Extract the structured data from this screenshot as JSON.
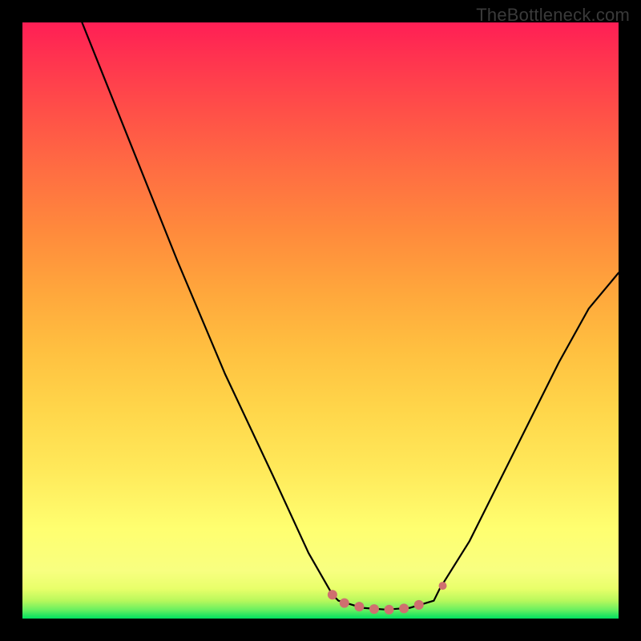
{
  "watermark": "TheBottleneck.com",
  "colors": {
    "curve": "#000000",
    "marker_pink": "#cf6f6f",
    "background_black": "#000000"
  },
  "chart_data": {
    "type": "line",
    "title": "",
    "xlabel": "",
    "ylabel": "",
    "xlim": [
      0,
      100
    ],
    "ylim": [
      0,
      100
    ],
    "left_branch": [
      {
        "x": 10,
        "y": 100
      },
      {
        "x": 18,
        "y": 80
      },
      {
        "x": 26,
        "y": 60
      },
      {
        "x": 34,
        "y": 41
      },
      {
        "x": 42,
        "y": 24
      },
      {
        "x": 48,
        "y": 11
      },
      {
        "x": 52,
        "y": 4
      }
    ],
    "trough": [
      {
        "x": 53,
        "y": 3
      },
      {
        "x": 57,
        "y": 1.8
      },
      {
        "x": 61,
        "y": 1.5
      },
      {
        "x": 65,
        "y": 1.8
      },
      {
        "x": 69,
        "y": 3
      }
    ],
    "right_branch": [
      {
        "x": 70,
        "y": 5
      },
      {
        "x": 75,
        "y": 13
      },
      {
        "x": 80,
        "y": 23
      },
      {
        "x": 85,
        "y": 33
      },
      {
        "x": 90,
        "y": 43
      },
      {
        "x": 95,
        "y": 52
      },
      {
        "x": 100,
        "y": 58
      }
    ],
    "markers_pink": [
      {
        "x": 52,
        "y": 4.0,
        "r": 6
      },
      {
        "x": 54,
        "y": 2.6,
        "r": 6
      },
      {
        "x": 56.5,
        "y": 2.0,
        "r": 6
      },
      {
        "x": 59,
        "y": 1.6,
        "r": 6
      },
      {
        "x": 61.5,
        "y": 1.5,
        "r": 6
      },
      {
        "x": 64,
        "y": 1.7,
        "r": 6
      },
      {
        "x": 66.5,
        "y": 2.3,
        "r": 6
      },
      {
        "x": 70.5,
        "y": 5.5,
        "r": 5
      }
    ]
  }
}
